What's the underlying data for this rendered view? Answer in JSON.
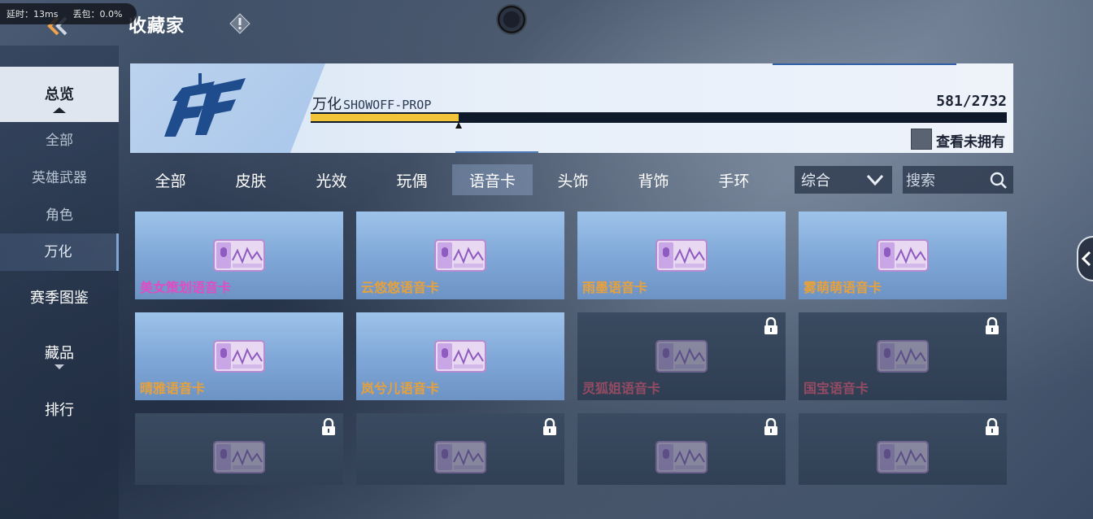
{
  "status": {
    "latency": "延时：13ms",
    "packet_loss": "丢包：0.0%"
  },
  "header": {
    "title": "收藏家"
  },
  "sidebar": {
    "items": [
      {
        "label": "总览"
      },
      {
        "label": "全部"
      },
      {
        "label": "英雄武器"
      },
      {
        "label": "角色"
      },
      {
        "label": "万化"
      },
      {
        "label": "赛季图鉴"
      },
      {
        "label": "藏品"
      },
      {
        "label": "排行"
      }
    ]
  },
  "banner": {
    "name": "万化",
    "subname": "SHOWOFF-PROP",
    "count": "581/2732",
    "progress": 0.213,
    "unowned_label": "查看未拥有"
  },
  "tabs": [
    "全部",
    "皮肤",
    "光效",
    "玩偶",
    "语音卡",
    "头饰",
    "背饰",
    "手环"
  ],
  "sort": {
    "value": "综合"
  },
  "search": {
    "placeholder": "搜索"
  },
  "cards": [
    {
      "label": "美女策划语音卡",
      "owned": true,
      "color": "#e04cc6"
    },
    {
      "label": "云悠悠语音卡",
      "owned": true,
      "color": "#e8a13a"
    },
    {
      "label": "雨墨语音卡",
      "owned": true,
      "color": "#e8a13a"
    },
    {
      "label": "雾萌萌语音卡",
      "owned": true,
      "color": "#e8a13a"
    },
    {
      "label": "晴雅语音卡",
      "owned": true,
      "color": "#e8a13a"
    },
    {
      "label": "岚兮儿语音卡",
      "owned": true,
      "color": "#e8a13a"
    },
    {
      "label": "灵狐姐语音卡",
      "owned": false,
      "color": "#c0506a"
    },
    {
      "label": "国宝语音卡",
      "owned": false,
      "color": "#c0506a"
    },
    {
      "label": "",
      "owned": false,
      "color": "#c0506a"
    },
    {
      "label": "",
      "owned": false,
      "color": "#c0506a"
    },
    {
      "label": "",
      "owned": false,
      "color": "#c0506a"
    },
    {
      "label": "",
      "owned": false,
      "color": "#c0506a"
    }
  ],
  "colors": {
    "accent": "#f2c43a",
    "active_nav": "#dfe6ef"
  }
}
